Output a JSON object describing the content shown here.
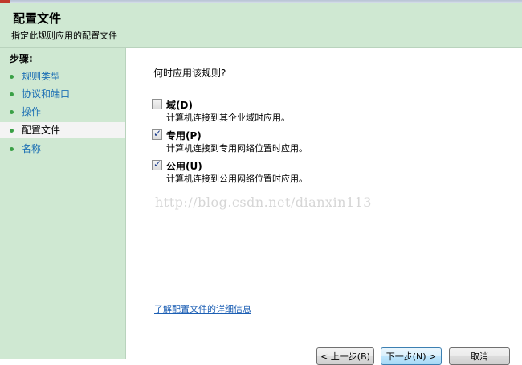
{
  "header": {
    "title": "配置文件",
    "subtitle": "指定此规则应用的配置文件"
  },
  "sidebar": {
    "heading": "步骤:",
    "steps": [
      {
        "label": "规则类型",
        "current": false
      },
      {
        "label": "协议和端口",
        "current": false
      },
      {
        "label": "操作",
        "current": false
      },
      {
        "label": "配置文件",
        "current": true
      },
      {
        "label": "名称",
        "current": false
      }
    ]
  },
  "main": {
    "question": "何时应用该规则?",
    "options": [
      {
        "label": "域(D)",
        "description": "计算机连接到其企业域时应用。",
        "checked": false
      },
      {
        "label": "专用(P)",
        "description": "计算机连接到专用网络位置时应用。",
        "checked": true
      },
      {
        "label": "公用(U)",
        "description": "计算机连接到公用网络位置时应用。",
        "checked": true
      }
    ],
    "watermark": "http://blog.csdn.net/dianxin113",
    "learn_more": "了解配置文件的详细信息"
  },
  "buttons": {
    "back": "< 上一步(B)",
    "next": "下一步(N) >",
    "cancel": "取消"
  },
  "colors": {
    "panel_green": "#cfe8d2",
    "link_blue": "#1c6fb4",
    "bullet_green": "#3aa046"
  }
}
